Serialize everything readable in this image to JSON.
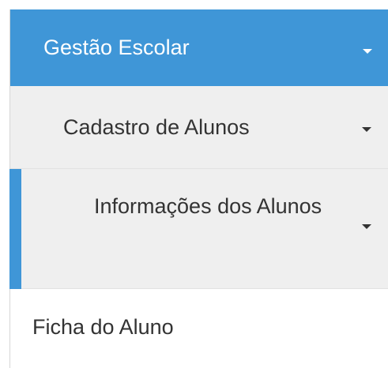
{
  "menu": {
    "section": {
      "label": "Gestão Escolar",
      "icon": "caret-down-icon"
    },
    "submenu": {
      "label": "Cadastro de Alunos",
      "icon": "caret-down-icon"
    },
    "subsubmenu": {
      "label": "Informações dos Alunos",
      "icon": "caret-down-icon",
      "active": true
    },
    "item": {
      "label": "Ficha do Aluno"
    }
  },
  "colors": {
    "primary": "#3f96d7",
    "submenu_bg": "#efefef",
    "text": "#333333"
  }
}
